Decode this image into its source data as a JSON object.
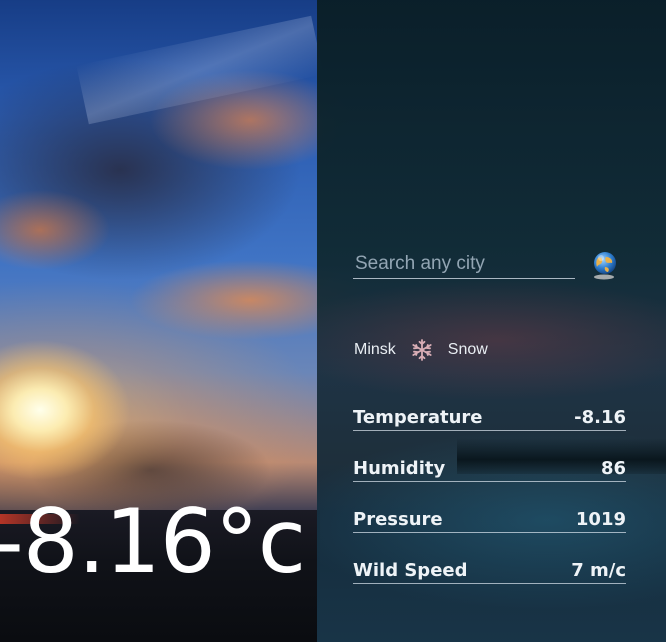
{
  "current": {
    "big_temperature": "-8.16°c"
  },
  "search": {
    "placeholder": "Search any city",
    "value": ""
  },
  "location": {
    "city": "Minsk",
    "condition": "Snow",
    "condition_icon": "snowflake-icon"
  },
  "stats": [
    {
      "label": "Temperature",
      "value": "-8.16"
    },
    {
      "label": "Humidity",
      "value": "86"
    },
    {
      "label": "Pressure",
      "value": "1019"
    },
    {
      "label": "Wild Speed",
      "value": "7 m/c"
    }
  ],
  "colors": {
    "text": "#eef3f7",
    "panel": "#0f2830",
    "underline": "#dce6f0"
  }
}
